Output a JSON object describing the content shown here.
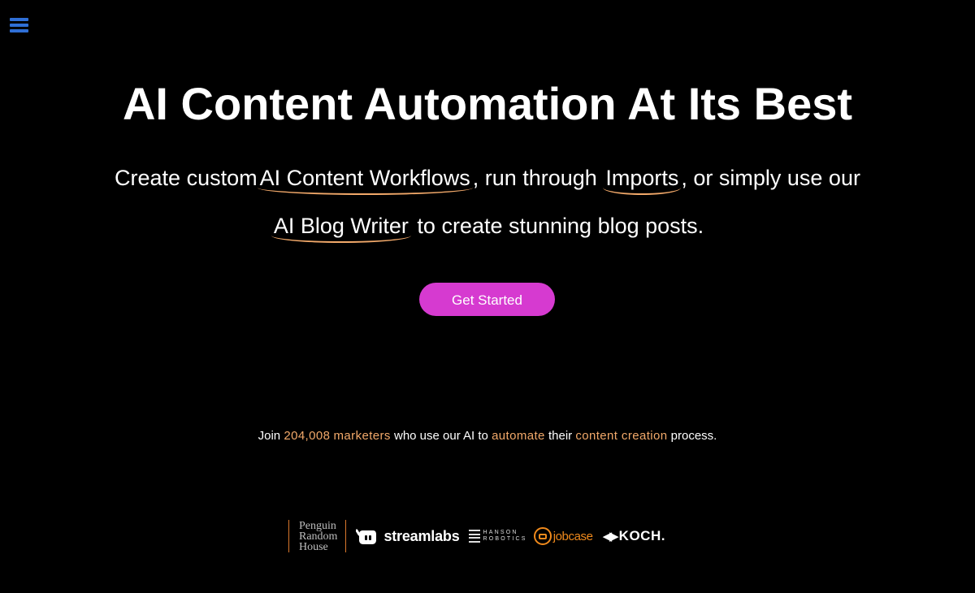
{
  "nav": {
    "menu_icon": "hamburger-icon",
    "accent_color": "#2f6fd6"
  },
  "hero": {
    "title": "AI Content Automation At Its Best",
    "subtitle_part1": "Create custom",
    "link_workflows": "AI Content Workflows",
    "subtitle_part2": ", run through",
    "link_imports": "Imports",
    "subtitle_part3": ", or simply use our",
    "link_blog_writer": "AI Blog Writer",
    "subtitle_part4": "to create stunning blog posts.",
    "cta_label": "Get Started",
    "cta_color": "#d63ad0",
    "underline_color": "#f2a96a"
  },
  "social_proof": {
    "part1": "Join",
    "count": "204,008",
    "highlight_marketers": "marketers",
    "part2": "who use our AI to",
    "highlight_automate": "automate",
    "part3": "their",
    "highlight_content_creation": "content creation",
    "part4": "process."
  },
  "logos": {
    "penguin": [
      "Penguin",
      "Random",
      "House"
    ],
    "streamlabs": "streamlabs",
    "hanson": [
      "HANSON",
      "ROBOTICS"
    ],
    "jobcase": "jobcase",
    "koch": "KOCH."
  }
}
